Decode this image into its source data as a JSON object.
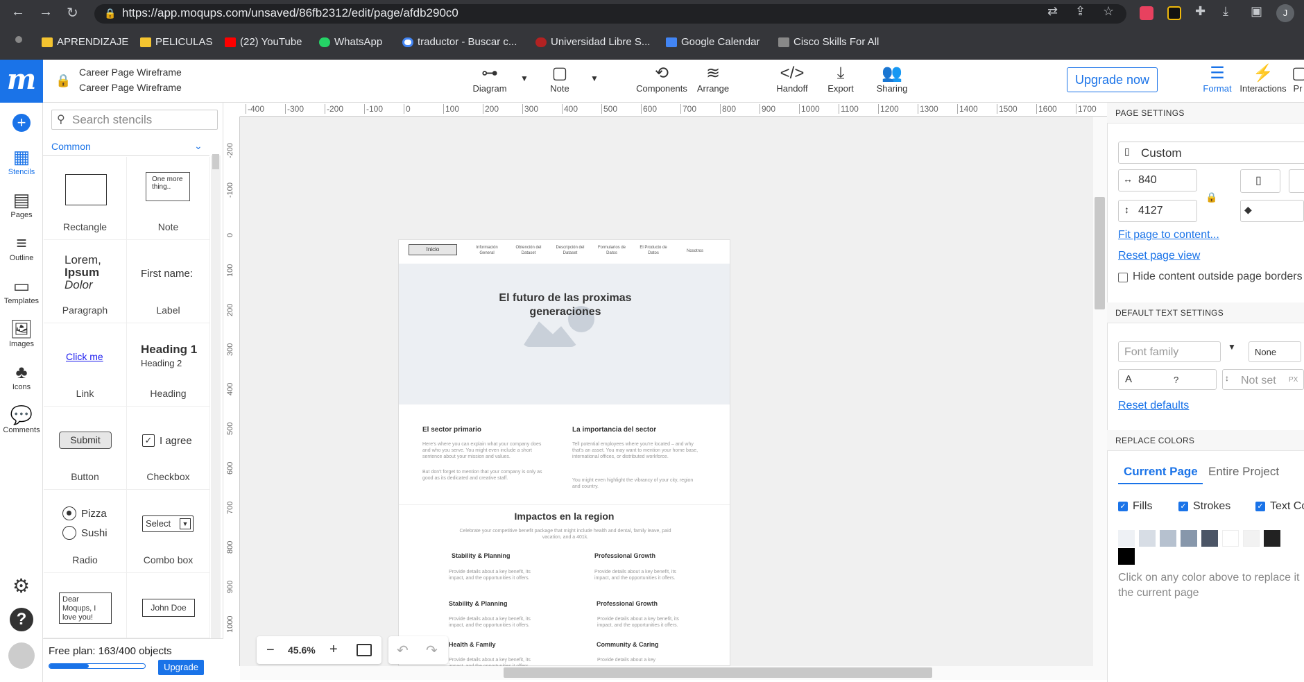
{
  "browser": {
    "url": "https://app.moqups.com/unsaved/86fb2312/edit/page/afdb290c0",
    "bookmarks": [
      "APRENDIZAJE",
      "PELICULAS",
      "(22) YouTube",
      "WhatsApp",
      "traductor - Buscar c...",
      "Universidad Libre S...",
      "Google Calendar",
      "Cisco Skills For All"
    ],
    "profile_initial": "J"
  },
  "header": {
    "doc_title": "Career Page Wireframe",
    "page_title": "Career Page Wireframe",
    "tools": [
      "Diagram",
      "Note",
      "Components",
      "Arrange",
      "Handoff",
      "Export",
      "Sharing"
    ],
    "upgrade_label": "Upgrade now",
    "right_tabs": [
      "Format",
      "Interactions",
      "Pr"
    ]
  },
  "rail": {
    "items": [
      "Stencils",
      "Pages",
      "Outline",
      "Templates",
      "Images",
      "Icons",
      "Comments"
    ]
  },
  "stencils": {
    "search_placeholder": "Search stencils",
    "category": "Common",
    "note_text": "One more thing..",
    "lorem": [
      "Lorem,",
      "Ipsum",
      "Dolor"
    ],
    "first_name": "First name:",
    "link_text": "Click me",
    "heading1": "Heading 1",
    "heading2": "Heading 2",
    "submit": "Submit",
    "agree": "I agree",
    "pizza": "Pizza",
    "sushi": "Sushi",
    "select": "Select",
    "dear": "Dear Moqups, I love you!",
    "john": "John Doe",
    "labels": [
      "Rectangle",
      "Note",
      "Paragraph",
      "Label",
      "Link",
      "Heading",
      "Button",
      "Checkbox",
      "Radio",
      "Combo box"
    ],
    "plan_text": "Free plan: 163/400 objects",
    "plan_progress": 0.41,
    "upgrade_label": "Upgrade"
  },
  "rulers": {
    "h": [
      "-400",
      "-300",
      "-200",
      "-100",
      "0",
      "100",
      "200",
      "300",
      "400",
      "500",
      "600",
      "700",
      "800",
      "900",
      "1000",
      "1100",
      "1200",
      "1300",
      "1400",
      "1500",
      "1600",
      "1700"
    ],
    "v": [
      "-200",
      "-100",
      "0",
      "100",
      "200",
      "300",
      "400",
      "500",
      "600",
      "700",
      "800",
      "900",
      "1000"
    ]
  },
  "wireframe": {
    "nav": [
      "Inicio",
      "Información General",
      "Obtención del Dataset",
      "Descripción del Dataset",
      "Formularios de Datos",
      "El Producto de Datos",
      "Nosotros"
    ],
    "hero_title": "El futuro de las proximas generaciones",
    "col1_title": "El sector primario",
    "col1_text": "Here's where you can explain what your company does and who you serve. You might even include a short sentence about your mission and values.",
    "col1_text2": "But don't forget to mention that your company is only as good as its dedicated and creative staff.",
    "col2_title": "La importancia del sector",
    "col2_text": "Tell potential employees where you're located – and why that's an asset. You may want to mention your home base, international offices, or distributed workforce.",
    "col2_text2": "You might even highlight the vibrancy of your city, region and country.",
    "impact_title": "Impactos en la region",
    "impact_sub": "Celebrate your competitive benefit package that might include health and dental, family leave, paid vacation, and a 401k.",
    "benefits": [
      "Stability & Planning",
      "Professional Growth",
      "Stability & Planning",
      "Professional Growth",
      "Health & Family",
      "Community & Caring"
    ],
    "benefit_text": "Provide details about a key benefit, its impact, and the opportunities it offers."
  },
  "zoom": {
    "value": "45.6%"
  },
  "right_panel": {
    "page_settings": "PAGE SETTINGS",
    "size_preset": "Custom",
    "width": "840",
    "height": "4127",
    "fit_link": "Fit page to content...",
    "reset_link": "Reset page view",
    "hide_label": "Hide content outside page borders",
    "default_text": "DEFAULT TEXT SETTINGS",
    "font_family": "Font family",
    "none": "None",
    "font_size": "?",
    "not_set": "Not set",
    "px": "PX",
    "reset_defaults": "Reset defaults",
    "replace_colors": "REPLACE COLORS",
    "tab_current": "Current Page",
    "tab_entire": "Entire Project",
    "fills": "Fills",
    "strokes": "Strokes",
    "text_colors": "Text Co",
    "swatches": [
      "#eef1f5",
      "#d7dde5",
      "#b6c1cf",
      "#8797ab",
      "#4b5566",
      "#ffffff",
      "#f2f2f2",
      "#222222",
      "#000000"
    ],
    "hint": "Click on any color above to replace it the current page"
  }
}
